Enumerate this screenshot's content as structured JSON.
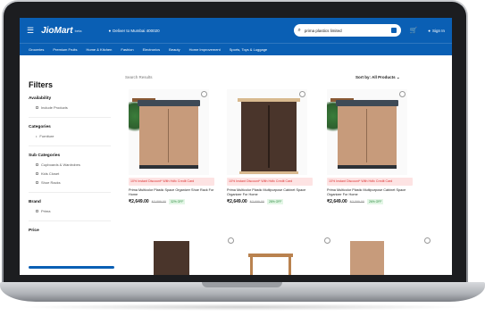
{
  "header": {
    "brand": "JioMart",
    "brand_sub": "beta",
    "deliver": "Deliver to Mumbai 400020",
    "search_value": "prima plastics limited",
    "signin": "Sign In"
  },
  "nav": [
    "Groceries",
    "Premium Fruits",
    "Home & Kitchen",
    "Fashion",
    "Electronics",
    "Beauty",
    "Home Improvement",
    "Sports, Toys & Luggage"
  ],
  "sidebar": {
    "title": "Filters",
    "availability": {
      "label": "Availability",
      "items": [
        "Include Products"
      ]
    },
    "categories": {
      "label": "Categories",
      "items": [
        "Furniture"
      ]
    },
    "sub_categories": {
      "label": "Sub Categories",
      "items": [
        "Cupboards & Wardrobes",
        "Kids Closet",
        "Shoe Racks"
      ]
    },
    "brand": {
      "label": "Brand",
      "items": [
        "Prima"
      ]
    },
    "price": {
      "label": "Price"
    }
  },
  "main": {
    "search_placeholder": "Search Results",
    "sort": "Sort by: All Products"
  },
  "products": [
    {
      "promo": "10% Instant Discount* With Hdfc Credit Card",
      "title": "Prima Multicolor Plastic Space Organizer Shoe Rack For Home",
      "price": "₹2,649.00",
      "mrp": "₹3,899.00",
      "off": "32% OFF"
    },
    {
      "promo": "10% Instant Discount* With Hdfc Credit Card",
      "title": "Prima Multicolor Plastic Multipurpose Cabinet Space Organizer For Home",
      "price": "₹2,649.00",
      "mrp": "₹3,699.00",
      "off": "28% OFF"
    },
    {
      "promo": "10% Instant Discount* With Hdfc Credit Card",
      "title": "Prima Multicolor Plastic Multipurpose Cabinet Space Organizer For Home",
      "price": "₹2,649.00",
      "mrp": "₹3,599.00",
      "off": "26% OFF"
    }
  ],
  "colors": {
    "brand_blue": "#0a5fb4",
    "promo_red": "#d33333",
    "off_green": "#2a8a3c"
  }
}
